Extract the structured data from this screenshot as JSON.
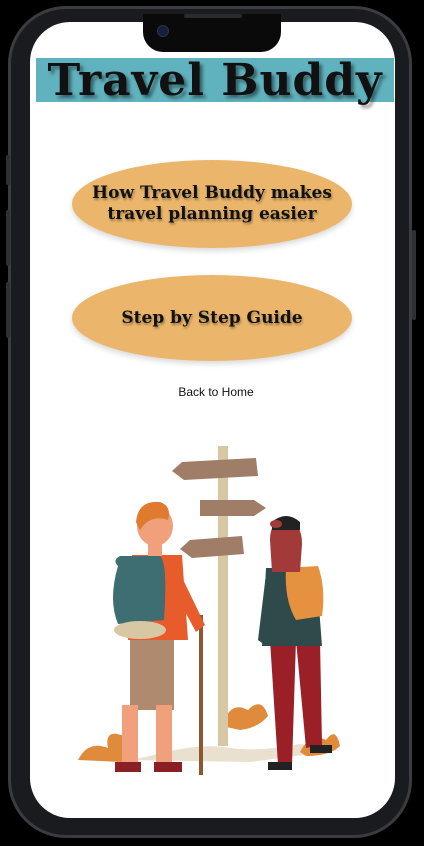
{
  "app": {
    "title": "Travel Buddy"
  },
  "buttons": {
    "how_it_works": "How Travel Buddy makes travel planning easier",
    "guide": "Step by Step Guide",
    "back_home": "Back to Home"
  },
  "colors": {
    "title_bar": "#5fb2be",
    "button_fill": "#ebb66b",
    "background": "#ffffff"
  },
  "illustration": {
    "name": "travelers-at-signpost"
  }
}
